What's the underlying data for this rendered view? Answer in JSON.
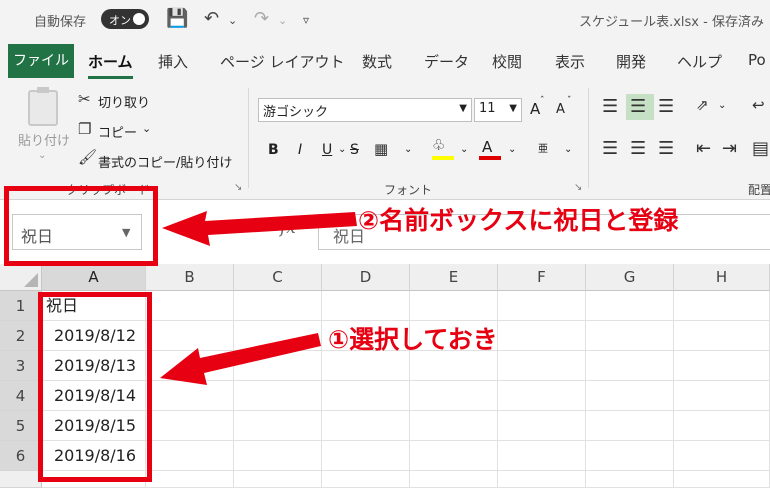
{
  "titlebar": {
    "autosave_label": "自動保存",
    "autosave_toggle": "オン",
    "document_title": "スケジュール表.xlsx  -  保存済み"
  },
  "tabs": [
    "ファイル",
    "ホーム",
    "挿入",
    "ページ レイアウト",
    "数式",
    "データ",
    "校閲",
    "表示",
    "開発",
    "ヘルプ",
    "Po"
  ],
  "active_tab": "ホーム",
  "ribbon": {
    "clipboard": {
      "paste_label": "貼り付け",
      "cut_label": "切り取り",
      "copy_label": "コピー",
      "format_painter_label": "書式のコピー/貼り付け",
      "group_label": "クリップボード"
    },
    "font": {
      "font_name": "游ゴシック",
      "font_size": "11",
      "bold": "B",
      "italic": "I",
      "underline": "U",
      "strikethrough": "S",
      "increase_size": "A",
      "decrease_size": "A",
      "group_label": "フォント",
      "furigana": "亜"
    },
    "alignment_group_label": "配置"
  },
  "formula_bar": {
    "name_box_value": "祝日",
    "fx_label": "fx",
    "formula_value": "祝日"
  },
  "sheet": {
    "columns": [
      "A",
      "B",
      "C",
      "D",
      "E",
      "F",
      "G",
      "H"
    ],
    "rows": [
      "1",
      "2",
      "3",
      "4",
      "5",
      "6"
    ],
    "column_a_values": [
      "祝日",
      "2019/8/12",
      "2019/8/13",
      "2019/8/14",
      "2019/8/15",
      "2019/8/16"
    ]
  },
  "annotations": {
    "callout_1": "①選択しておき",
    "callout_2": "②名前ボックスに祝日と登録",
    "color": "#e60012"
  },
  "colors": {
    "excel_green": "#217346",
    "annotation_red": "#e60012"
  }
}
